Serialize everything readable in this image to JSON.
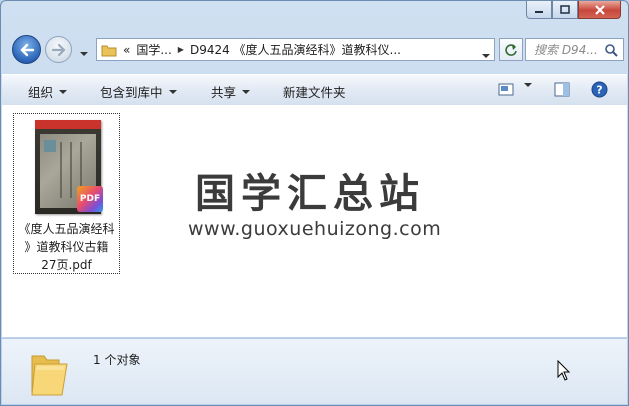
{
  "window": {
    "caption": {
      "minimize_glyph": "–",
      "maximize_glyph": "□",
      "close_glyph": "✕"
    }
  },
  "nav": {
    "back_glyph": "←",
    "forward_glyph": "→",
    "address": {
      "overflow_glyph": "«",
      "crumbs": [
        "国学...",
        "D9424 《度人五品演经科》道教科仪..."
      ]
    },
    "search": {
      "placeholder": "搜索 D94..."
    }
  },
  "toolbar": {
    "organize": "组织",
    "include_in_library": "包含到库中",
    "share": "共享",
    "new_folder": "新建文件夹"
  },
  "content": {
    "files": [
      {
        "name": "《度人五品演经科》道教科仪古籍27页.pdf",
        "name_lines": [
          "《度人五品演经科",
          "》道教科仪古籍",
          "27页.pdf"
        ],
        "badge": "PDF"
      }
    ],
    "watermark": {
      "title": "国学汇总站",
      "url": "www.guoxuehuizong.com"
    }
  },
  "status": {
    "item_count": "1 个对象"
  },
  "colors": {
    "accent": "#2a63b8",
    "close": "#c7473a"
  }
}
